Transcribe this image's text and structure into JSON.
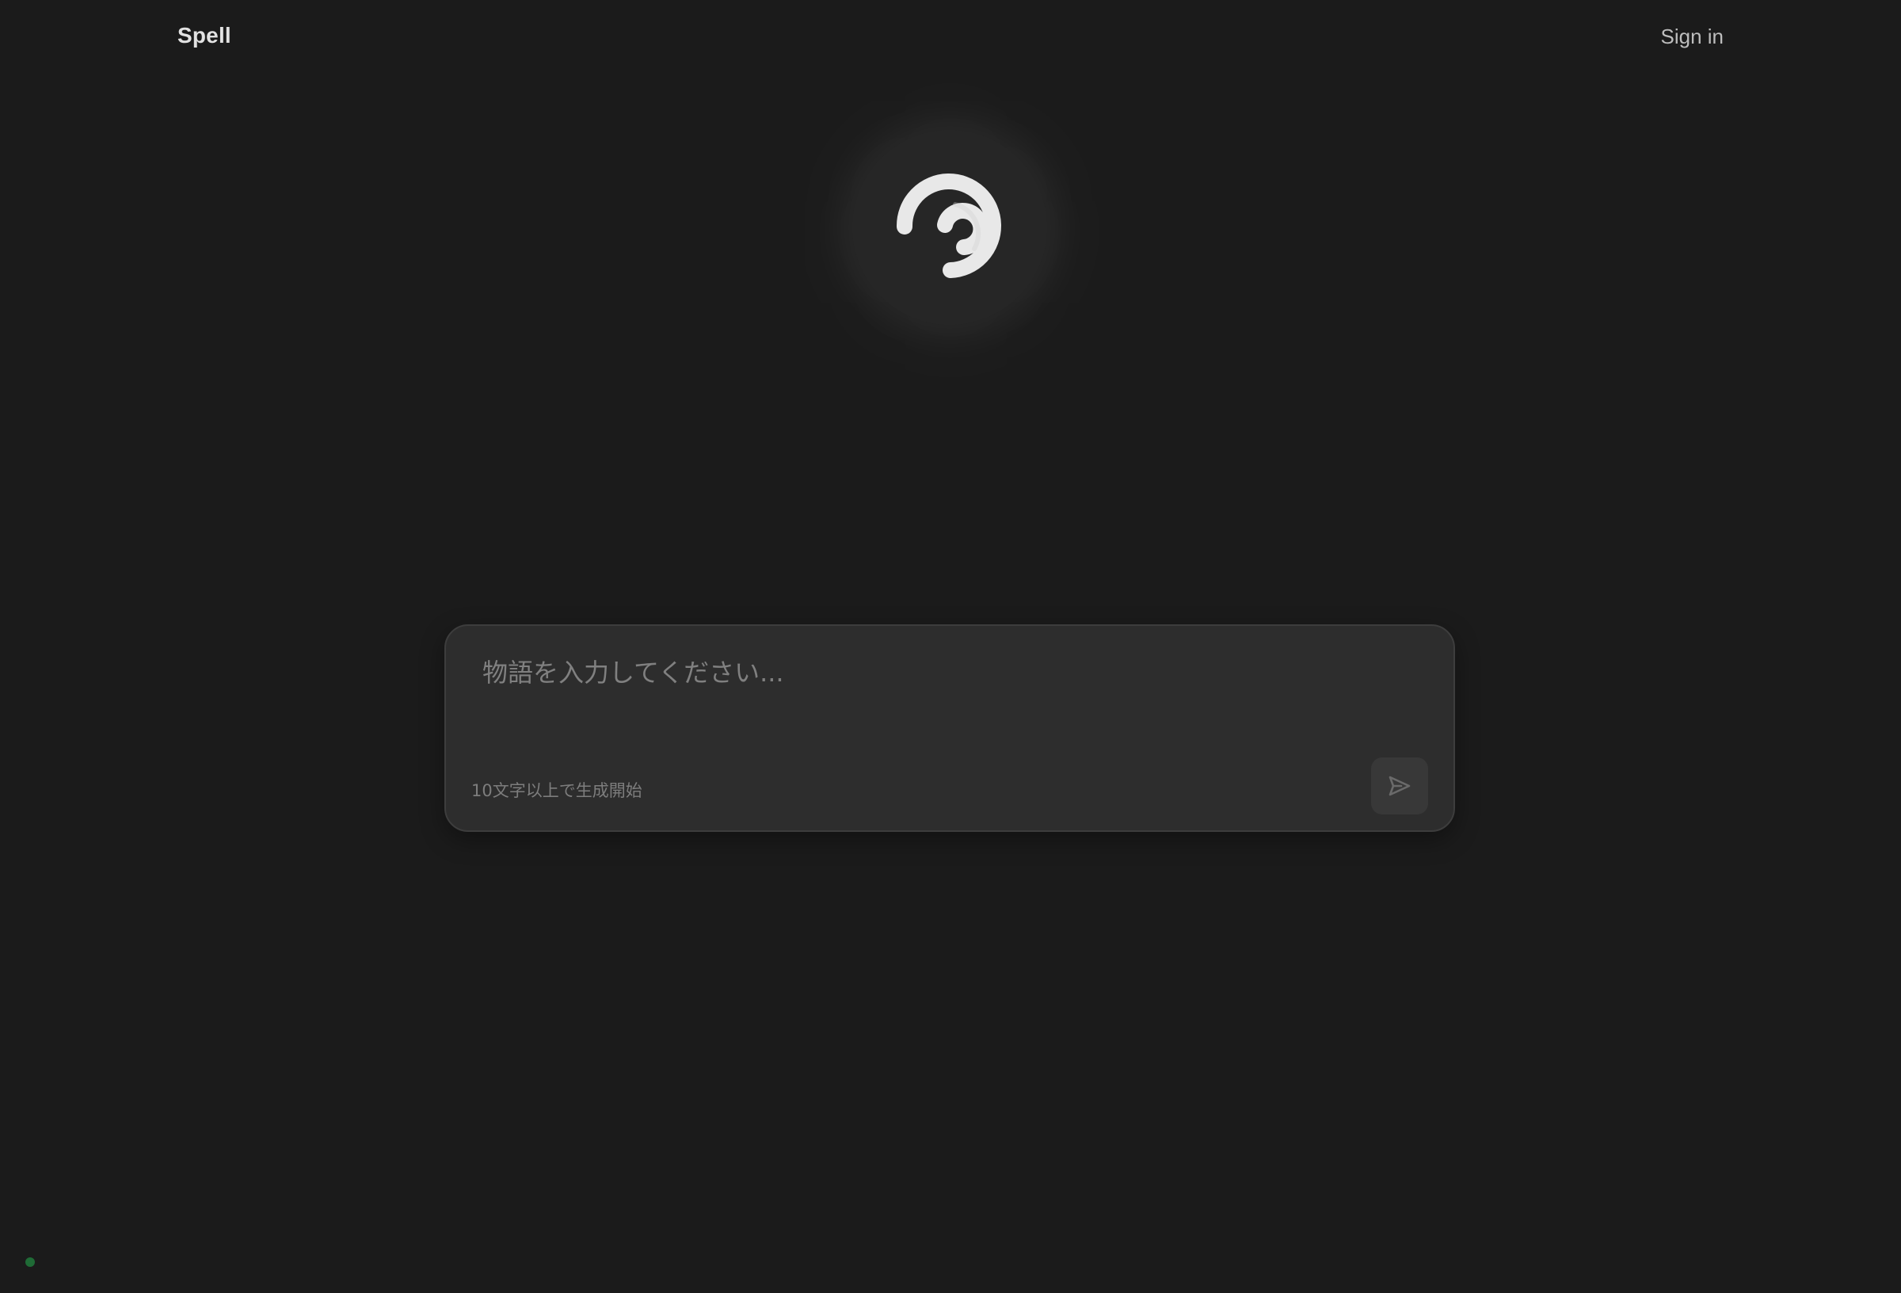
{
  "header": {
    "brand": "Spell",
    "signin_label": "Sign in"
  },
  "logo": {
    "icon": "spinner-swirl-icon"
  },
  "composer": {
    "placeholder": "物語を入力してください...",
    "value": "",
    "hint": "10文字以上で生成開始",
    "send_icon": "send-icon"
  },
  "status": {
    "indicator_color": "#1f6b36"
  },
  "colors": {
    "background": "#1b1b1b",
    "card": "#2d2d2d",
    "accent_green": "#1f6b36"
  }
}
